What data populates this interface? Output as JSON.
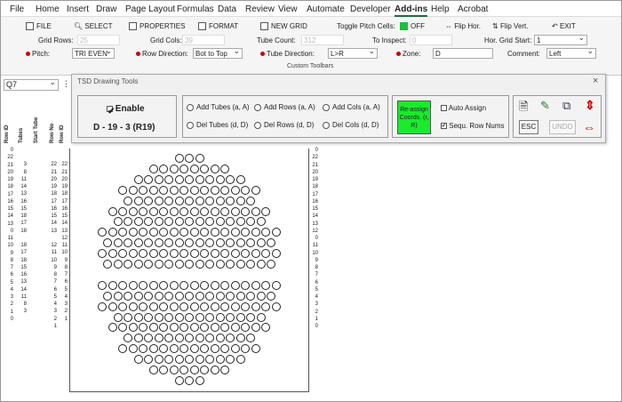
{
  "menu": [
    "File",
    "Home",
    "Insert",
    "Draw",
    "Page Layout",
    "Formulas",
    "Data",
    "Review",
    "View",
    "Automate",
    "Developer",
    "Add-ins",
    "Help",
    "Acrobat"
  ],
  "toolbar": {
    "file": "FILE",
    "select": "SELECT",
    "properties": "PROPERTIES",
    "format": "FORMAT",
    "new_grid": "NEW GRID",
    "toggle_pitch": "Toggle Pitch Cells:",
    "pitch_state": "OFF",
    "flip_hor": "Flip Hor.",
    "flip_vert": "Flip Vert.",
    "exit": "EXIT",
    "grid_rows_label": "Grid Rows:",
    "grid_rows": "25",
    "grid_cols_label": "Grid Cols:",
    "grid_cols": "39",
    "tube_count_label": "Tube Count:",
    "tube_count": "312",
    "to_inspect_label": "To Inspect:",
    "to_inspect": "0",
    "hor_grid_start_label": "Hor. Grid Start:",
    "hor_grid_start": "1",
    "pitch_label": "Pitch:",
    "pitch": "TRI EVEN",
    "row_dir_label": "Row Direction:",
    "row_dir": "Bot to Top",
    "tube_dir_label": "Tube Direction:",
    "tube_dir": "L>R",
    "zone_label": "Zone:",
    "zone": "D",
    "comment_label": "Comment:",
    "comment": "Left",
    "group": "Custom Toolbars"
  },
  "namebox": "Q7",
  "panel": {
    "title": "TSD Drawing Tools",
    "enable": "Enable",
    "coord": "D - 19 - 3 (R19)",
    "add_tubes": "Add Tubes (a, A)",
    "add_rows": "Add Rows (a, A)",
    "add_cols": "Add Cols (a, A)",
    "del_tubes": "Del Tubes (d, D)",
    "del_rows": "Del Rows (d, D)",
    "del_cols": "Del Cols (d, D)",
    "reassign": "Re-assign Coords. (r, R)",
    "auto_assign": "Auto Assign",
    "sequ": "Sequ. Row Nums",
    "esc": "ESC",
    "undo": "UNDO",
    "close": "×"
  },
  "headers": {
    "row_id": "Row ID",
    "tubes": "Tubes",
    "start_tube": "Start Tube",
    "row_no": "Row No",
    "row_id2": "Row ID"
  },
  "colA": [
    "0",
    "22",
    "21",
    "20",
    "19",
    "18",
    "17",
    "16",
    "15",
    "14",
    "13",
    "0",
    "11",
    "10",
    "9",
    "8",
    "7",
    "6",
    "5",
    "4",
    "3",
    "2",
    "1",
    "0"
  ],
  "colB": [
    "",
    "3",
    "8",
    "11",
    "14",
    "13",
    "16",
    "15",
    "18",
    "17",
    "18",
    "",
    "18",
    "17",
    "18",
    "15",
    "16",
    "13",
    "14",
    "11",
    "8",
    "3",
    "",
    ""
  ],
  "colC": [
    "",
    "22",
    "21",
    "20",
    "19",
    "18",
    "17",
    "16",
    "15",
    "14",
    "13",
    "",
    "12",
    "11",
    "10",
    "9",
    "8",
    "7",
    "6",
    "5",
    "4",
    "3",
    "2",
    "1",
    ""
  ],
  "colD": [
    "",
    "22",
    "21",
    "20",
    "19",
    "18",
    "17",
    "16",
    "15",
    "14",
    "13",
    "12",
    "11",
    "10",
    "9",
    "8",
    "7",
    "6",
    "5",
    "4",
    "3",
    "2",
    "1",
    ""
  ],
  "colR": [
    "0",
    "22",
    "21",
    "20",
    "19",
    "18",
    "17",
    "16",
    "15",
    "14",
    "13",
    "12",
    "0",
    "11",
    "10",
    "9",
    "8",
    "7",
    "6",
    "5",
    "4",
    "3",
    "2",
    "1",
    "0"
  ],
  "rows": [
    3,
    8,
    11,
    14,
    13,
    16,
    15,
    18,
    17,
    18,
    17,
    0,
    18,
    17,
    18,
    15,
    16,
    13,
    14,
    11,
    8,
    3
  ],
  "colors": {
    "accent": "#1a6f3c",
    "green": "#1bbf3a",
    "red": "#cc0000"
  }
}
